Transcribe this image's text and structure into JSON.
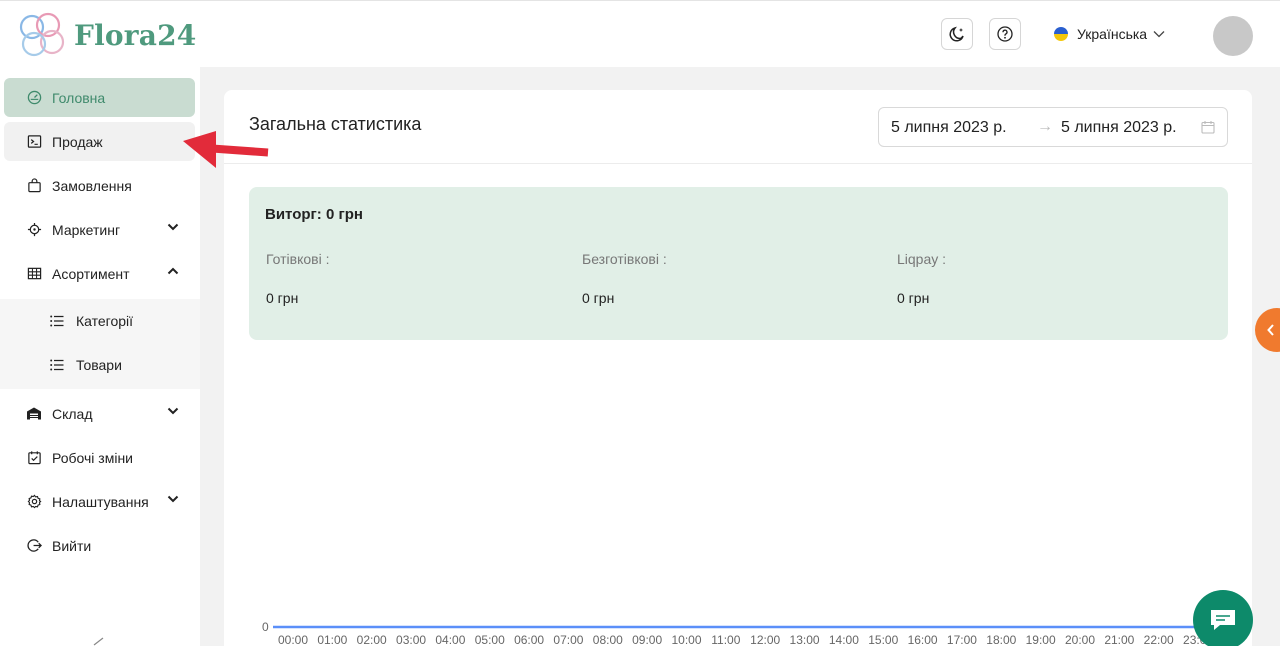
{
  "app": {
    "logo_text": "Flora24"
  },
  "header": {
    "language": "Українська",
    "theme_icon": "moon-icon",
    "help_icon": "question-icon"
  },
  "sidebar": {
    "items": [
      {
        "label": "Головна",
        "icon": "dashboard-icon",
        "active": true
      },
      {
        "label": "Продаж",
        "icon": "terminal-icon"
      },
      {
        "label": "Замовлення",
        "icon": "bag-icon"
      },
      {
        "label": "Маркетинг",
        "icon": "target-icon",
        "expandable": true
      },
      {
        "label": "Асортимент",
        "icon": "table-icon",
        "expanded": true
      },
      {
        "label": "Склад",
        "icon": "warehouse-icon",
        "expandable": true
      },
      {
        "label": "Робочі зміни",
        "icon": "calendar-check-icon"
      },
      {
        "label": "Налаштування",
        "icon": "gear-icon",
        "expandable": true
      },
      {
        "label": "Вийти",
        "icon": "logout-icon"
      }
    ],
    "sub_items": [
      {
        "label": "Категорії",
        "icon": "list-icon"
      },
      {
        "label": "Товари",
        "icon": "list-icon"
      }
    ]
  },
  "main": {
    "title": "Загальна статистика",
    "date_from": "5 липня 2023 р.",
    "date_to": "5 липня 2023 р.",
    "revenue": "Виторг: 0 грн",
    "stats": [
      {
        "label": "Готівкові :",
        "value": "0 грн"
      },
      {
        "label": "Безготівкові :",
        "value": "0 грн"
      },
      {
        "label": "Liqpay :",
        "value": "0 грн"
      }
    ]
  },
  "colors": {
    "brand": "#4f9a7e",
    "active_bg": "#c9dcd1",
    "stats_bg": "#e1efe7",
    "line": "#5b8ff9",
    "chat": "#0d8a6a",
    "orange": "#f07a2e",
    "arrow": "#e22b3a"
  },
  "chart_data": {
    "type": "line",
    "categories": [
      "00:00",
      "01:00",
      "02:00",
      "03:00",
      "04:00",
      "05:00",
      "06:00",
      "07:00",
      "08:00",
      "09:00",
      "10:00",
      "11:00",
      "12:00",
      "13:00",
      "14:00",
      "15:00",
      "16:00",
      "17:00",
      "18:00",
      "19:00",
      "20:00",
      "21:00",
      "22:00",
      "23:00"
    ],
    "series": [
      {
        "values": [
          0,
          0,
          0,
          0,
          0,
          0,
          0,
          0,
          0,
          0,
          0,
          0,
          0,
          0,
          0,
          0,
          0,
          0,
          0,
          0,
          0,
          0,
          0,
          0
        ]
      }
    ],
    "y_ticks": [
      "0"
    ],
    "grid": false
  }
}
